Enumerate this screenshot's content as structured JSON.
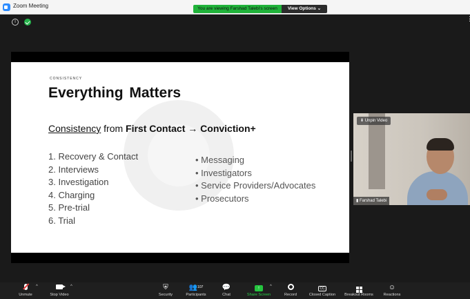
{
  "window": {
    "title": "Zoom Meeting"
  },
  "share_banner": {
    "text": "You are viewing Farshad Talebi's screen",
    "view_options": "View Options ⌄"
  },
  "slide": {
    "kicker": "CONSISTENCY",
    "title": "Everything  Matters",
    "subtitle_underlined": "Consistency",
    "subtitle_mid": " from ",
    "subtitle_bold": "First Contact → Conviction+",
    "left_list": [
      "1. Recovery & Contact",
      "2. Interviews",
      "3. Investigation",
      "4. Charging",
      "5. Pre-trial",
      "6. Trial"
    ],
    "right_list": [
      "• Messaging",
      "• Investigators",
      "• Service Providers/Advocates",
      "• Prosecutors"
    ]
  },
  "video": {
    "unpin_label": "Unpin Video",
    "name": "Farshad Talebi"
  },
  "toolbar": {
    "unmute": "Unmute",
    "stop_video": "Stop Video",
    "security": "Security",
    "participants": "Participants",
    "participant_count": "107",
    "chat": "Chat",
    "share_screen": "Share Screen",
    "record": "Record",
    "closed_caption": "Closed Caption",
    "breakout_rooms": "Breakout Rooms",
    "reactions": "Reactions"
  },
  "colors": {
    "share_green": "#20b33a",
    "accent_blue": "#2d8cff"
  }
}
